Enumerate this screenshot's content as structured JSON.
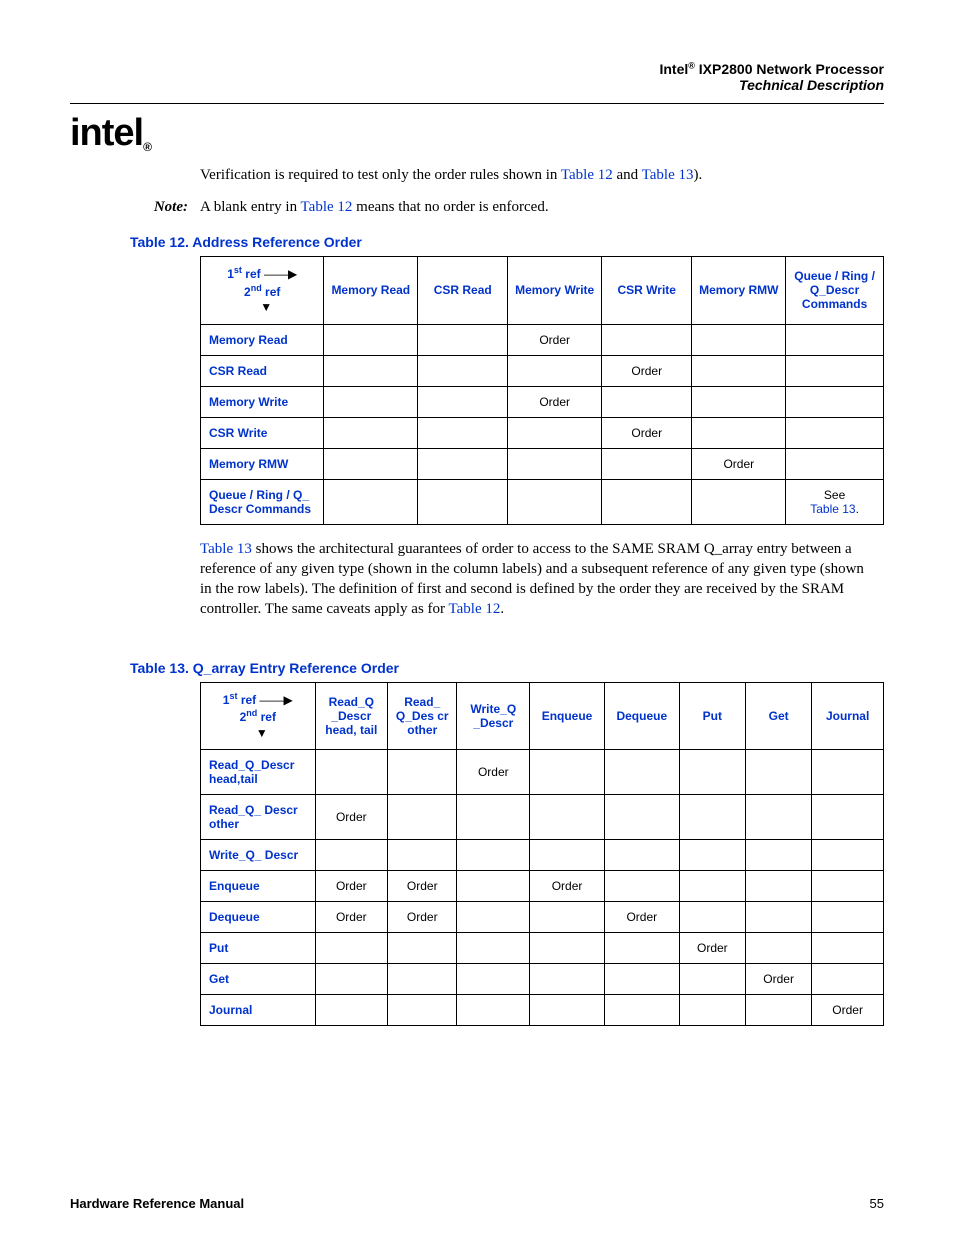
{
  "header": {
    "brand": "Intel",
    "reg": "®",
    "product": " IXP2800 Network Processor",
    "subtitle": "Technical Description"
  },
  "logo": {
    "text": "intel",
    "sub": "®"
  },
  "para1_a": "Verification is required to test only the order rules shown in ",
  "para1_link1": "Table 12",
  "para1_b": " and ",
  "para1_link2": "Table 13",
  "para1_c": ").",
  "note_label": "Note:",
  "note_a": "A blank entry in ",
  "note_link": "Table 12",
  "note_b": " means that no order is enforced.",
  "table12": {
    "caption": "Table 12.  Address Reference Order",
    "corner_l1a": "1",
    "corner_l1b": "st",
    "corner_l1c": " ref ",
    "corner_l2a": "2",
    "corner_l2b": "nd",
    "corner_l2c": " ref",
    "arrow_r": "——▶",
    "arrow_d": "▼",
    "cols": [
      "Memory Read",
      "CSR Read",
      "Memory Write",
      "CSR Write",
      "Memory RMW",
      "Queue / Ring / Q_Descr Commands"
    ],
    "rows": [
      {
        "h": "Memory Read",
        "c": [
          "",
          "",
          "Order",
          "",
          "",
          ""
        ]
      },
      {
        "h": "CSR Read",
        "c": [
          "",
          "",
          "",
          "Order",
          "",
          ""
        ]
      },
      {
        "h": "Memory Write",
        "c": [
          "",
          "",
          "Order",
          "",
          "",
          ""
        ]
      },
      {
        "h": "CSR Write",
        "c": [
          "",
          "",
          "",
          "Order",
          "",
          ""
        ]
      },
      {
        "h": "Memory RMW",
        "c": [
          "",
          "",
          "",
          "",
          "Order",
          ""
        ]
      },
      {
        "h": "Queue / Ring / Q_ Descr Commands",
        "c": [
          "",
          "",
          "",
          "",
          "",
          "__SEE__"
        ]
      }
    ],
    "see_a": "See",
    "see_link": "Table 13",
    "see_b": "."
  },
  "para2_link1": "Table 13",
  "para2_a": " shows the architectural guarantees of order to access to the SAME SRAM Q_array entry between a reference of any given type (shown in the column labels) and a subsequent reference of any given type (shown in the row labels). The definition of first and second is defined by the order they are received by the SRAM controller. The same caveats apply as for ",
  "para2_link2": "Table 12",
  "para2_b": ".",
  "table13": {
    "caption": "Table 13.  Q_array Entry Reference Order",
    "cols": [
      "Read_Q _Descr head, tail",
      "Read_ Q_Des cr other",
      "Write_Q _Descr",
      "Enqueue",
      "Dequeue",
      "Put",
      "Get",
      "Journal"
    ],
    "rows": [
      {
        "h": "Read_Q_Descr head,tail",
        "c": [
          "",
          "",
          "Order",
          "",
          "",
          "",
          "",
          ""
        ]
      },
      {
        "h": "Read_Q_ Descr other",
        "c": [
          "Order",
          "",
          "",
          "",
          "",
          "",
          "",
          ""
        ]
      },
      {
        "h": "Write_Q_ Descr",
        "c": [
          "",
          "",
          "",
          "",
          "",
          "",
          "",
          ""
        ]
      },
      {
        "h": "Enqueue",
        "c": [
          "Order",
          "Order",
          "",
          "Order",
          "",
          "",
          "",
          ""
        ]
      },
      {
        "h": "Dequeue",
        "c": [
          "Order",
          "Order",
          "",
          "",
          "Order",
          "",
          "",
          ""
        ]
      },
      {
        "h": "Put",
        "c": [
          "",
          "",
          "",
          "",
          "",
          "Order",
          "",
          ""
        ]
      },
      {
        "h": "Get",
        "c": [
          "",
          "",
          "",
          "",
          "",
          "",
          "Order",
          ""
        ]
      },
      {
        "h": "Journal",
        "c": [
          "",
          "",
          "",
          "",
          "",
          "",
          "",
          "Order"
        ]
      }
    ]
  },
  "footer": {
    "left": "Hardware Reference Manual",
    "right": "55"
  }
}
